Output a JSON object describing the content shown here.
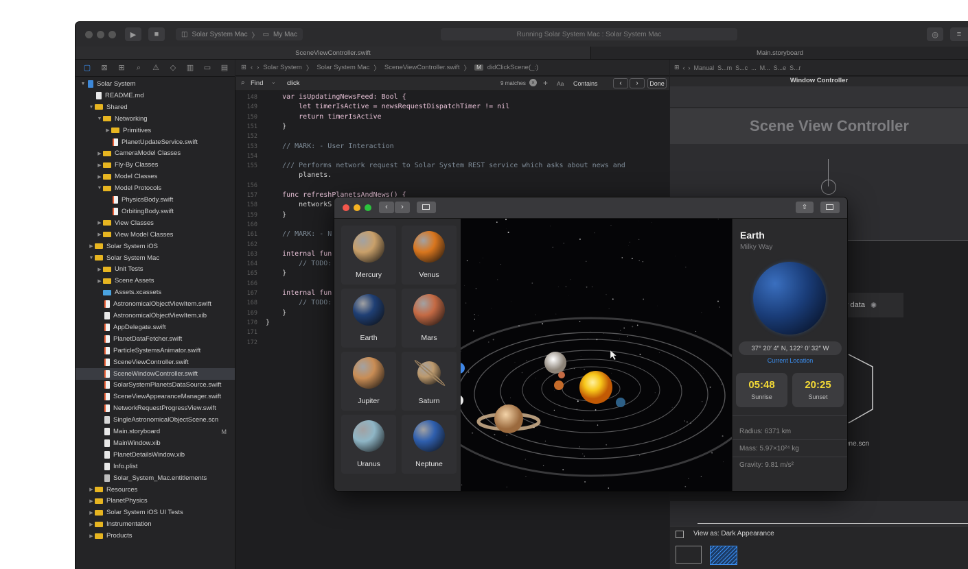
{
  "titlebar": {
    "scheme_target": "Solar System Mac",
    "scheme_destination": "My Mac",
    "activity": "Running Solar System Mac : Solar System Mac"
  },
  "tabs": [
    {
      "label": "SceneViewController.swift"
    },
    {
      "label": "Main.storyboard"
    }
  ],
  "navigator": {
    "items": [
      {
        "label": "Solar System",
        "kind": "proj",
        "depth": 0,
        "disc": "open"
      },
      {
        "label": "README.md",
        "kind": "file",
        "depth": 1,
        "disc": ""
      },
      {
        "label": "Shared",
        "kind": "folder",
        "depth": 1,
        "disc": "open"
      },
      {
        "label": "Networking",
        "kind": "folder",
        "depth": 2,
        "disc": "open"
      },
      {
        "label": "Primitives",
        "kind": "folder",
        "depth": 3,
        "disc": "closed"
      },
      {
        "label": "PlanetUpdateService.swift",
        "kind": "swift",
        "depth": 3,
        "disc": ""
      },
      {
        "label": "CameraModel Classes",
        "kind": "folder",
        "depth": 2,
        "disc": "closed"
      },
      {
        "label": "Fly-By Classes",
        "kind": "folder",
        "depth": 2,
        "disc": "closed"
      },
      {
        "label": "Model Classes",
        "kind": "folder",
        "depth": 2,
        "disc": "closed"
      },
      {
        "label": "Model Protocols",
        "kind": "folder",
        "depth": 2,
        "disc": "open"
      },
      {
        "label": "PhysicsBody.swift",
        "kind": "swift",
        "depth": 3,
        "disc": ""
      },
      {
        "label": "OrbitingBody.swift",
        "kind": "swift",
        "depth": 3,
        "disc": ""
      },
      {
        "label": "View Classes",
        "kind": "folder",
        "depth": 2,
        "disc": "closed"
      },
      {
        "label": "View Model Classes",
        "kind": "folder",
        "depth": 2,
        "disc": "closed"
      },
      {
        "label": "Solar System iOS",
        "kind": "folder",
        "depth": 1,
        "disc": "closed"
      },
      {
        "label": "Solar System Mac",
        "kind": "folder",
        "depth": 1,
        "disc": "open"
      },
      {
        "label": "Unit Tests",
        "kind": "folder",
        "depth": 2,
        "disc": "closed"
      },
      {
        "label": "Scene Assets",
        "kind": "folder",
        "depth": 2,
        "disc": "closed"
      },
      {
        "label": "Assets.xcassets",
        "kind": "bluefolder",
        "depth": 2,
        "disc": ""
      },
      {
        "label": "AstronomicalObjectViewItem.swift",
        "kind": "swift",
        "depth": 2,
        "disc": ""
      },
      {
        "label": "AstronomicalObjectViewItem.xib",
        "kind": "file",
        "depth": 2,
        "disc": ""
      },
      {
        "label": "AppDelegate.swift",
        "kind": "swift",
        "depth": 2,
        "disc": ""
      },
      {
        "label": "PlanetDataFetcher.swift",
        "kind": "swift",
        "depth": 2,
        "disc": ""
      },
      {
        "label": "ParticleSystemsAnimator.swift",
        "kind": "swift",
        "depth": 2,
        "disc": ""
      },
      {
        "label": "SceneViewController.swift",
        "kind": "swift",
        "depth": 2,
        "disc": ""
      },
      {
        "label": "SceneWindowController.swift",
        "kind": "swift",
        "depth": 2,
        "disc": "",
        "selected": true
      },
      {
        "label": "SolarSystemPlanetsDataSource.swift",
        "kind": "swift",
        "depth": 2,
        "disc": ""
      },
      {
        "label": "SceneViewAppearanceManager.swift",
        "kind": "swift",
        "depth": 2,
        "disc": ""
      },
      {
        "label": "NetworkRequestProgressView.swift",
        "kind": "swift",
        "depth": 2,
        "disc": ""
      },
      {
        "label": "SingleAstronomicalObjectScene.scn",
        "kind": "scn",
        "depth": 2,
        "disc": ""
      },
      {
        "label": "Main.storyboard",
        "kind": "file",
        "depth": 2,
        "disc": "",
        "badge": "M"
      },
      {
        "label": "MainWindow.xib",
        "kind": "file",
        "depth": 2,
        "disc": ""
      },
      {
        "label": "PlanetDetailsWindow.xib",
        "kind": "file",
        "depth": 2,
        "disc": ""
      },
      {
        "label": "Info.plist",
        "kind": "file",
        "depth": 2,
        "disc": ""
      },
      {
        "label": "Solar_System_Mac.entitlements",
        "kind": "ent",
        "depth": 2,
        "disc": ""
      },
      {
        "label": "Resources",
        "kind": "folder",
        "depth": 1,
        "disc": "closed"
      },
      {
        "label": "PlanetPhysics",
        "kind": "folder",
        "depth": 1,
        "disc": "closed"
      },
      {
        "label": "Solar System iOS UI Tests",
        "kind": "folder",
        "depth": 1,
        "disc": "closed"
      },
      {
        "label": "Instrumentation",
        "kind": "folder",
        "depth": 1,
        "disc": "closed"
      },
      {
        "label": "Products",
        "kind": "folder",
        "depth": 1,
        "disc": "closed"
      }
    ]
  },
  "jumpbar": {
    "crumbs": [
      "Solar System",
      "Solar System Mac",
      "SceneViewController.swift",
      "didClickScene(_:)"
    ],
    "method_badge": "M"
  },
  "find": {
    "mode": "Find",
    "query": "click",
    "matches": "9 matches",
    "case": "Aa",
    "option": "Contains",
    "done": "Done"
  },
  "code": {
    "lines": [
      {
        "n": "148",
        "t": "    var isUpdatingNewsFeed: Bool {"
      },
      {
        "n": "149",
        "t": "        let timerIsActive = newsRequestDispatchTimer != nil"
      },
      {
        "n": "150",
        "t": "        return timerIsActive"
      },
      {
        "n": "151",
        "t": "    }"
      },
      {
        "n": "152",
        "t": ""
      },
      {
        "n": "153",
        "t": "    // MARK: - User Interaction"
      },
      {
        "n": "154",
        "t": ""
      },
      {
        "n": "155",
        "t": "    /// Performs network request to Solar System REST service which asks about news and"
      },
      {
        "n": "",
        "t": "        planets."
      },
      {
        "n": "156",
        "t": ""
      },
      {
        "n": "157",
        "t": "    func refreshPlanetsAndNews() {"
      },
      {
        "n": "158",
        "t": "        networkS"
      },
      {
        "n": "159",
        "t": "    }"
      },
      {
        "n": "160",
        "t": ""
      },
      {
        "n": "161",
        "t": "    // MARK: - N"
      },
      {
        "n": "162",
        "t": ""
      },
      {
        "n": "163",
        "t": "    internal fun"
      },
      {
        "n": "164",
        "t": "        // TODO:"
      },
      {
        "n": "165",
        "t": "    }"
      },
      {
        "n": "166",
        "t": ""
      },
      {
        "n": "167",
        "t": "    internal fun"
      },
      {
        "n": "168",
        "t": "        // TODO:"
      },
      {
        "n": "169",
        "t": "    }"
      },
      {
        "n": "170",
        "t": "}"
      },
      {
        "n": "171",
        "t": ""
      },
      {
        "n": "172",
        "t": ""
      }
    ]
  },
  "ib": {
    "crumbs": [
      "Manual",
      "S...m",
      "S...c",
      "...",
      "M...",
      "S...e",
      "S...r"
    ],
    "window_controller": "Window Controller",
    "scene_title": "Scene View Controller",
    "fragment_data": "y data",
    "fragment_scn": "ene.scn",
    "view_as": "View as: Dark Appearance"
  },
  "app": {
    "planets": [
      {
        "name": "Mercury",
        "color": "#c9a06a"
      },
      {
        "name": "Venus",
        "color": "#d9761e"
      },
      {
        "name": "Earth",
        "color": "#1f3f74"
      },
      {
        "name": "Mars",
        "color": "#c46a44"
      },
      {
        "name": "Jupiter",
        "color": "#c98d55"
      },
      {
        "name": "Saturn",
        "color": "#bd9a6e"
      },
      {
        "name": "Uranus",
        "color": "#8fb6c6"
      },
      {
        "name": "Neptune",
        "color": "#2f5fae"
      }
    ],
    "detail": {
      "name": "Earth",
      "galaxy": "Milky Way",
      "coords": "37° 20′ 4″ N, 122° 0′ 32″ W",
      "location_link": "Current Location",
      "sunrise_time": "05:48",
      "sunrise_label": "Sunrise",
      "sunset_time": "20:25",
      "sunset_label": "Sunset",
      "radius": "Radius: 6371 km",
      "mass": "Mass: 5.97×10²⁴ kg",
      "gravity": "Gravity: 9.81 m/s²"
    }
  },
  "colors": {
    "accent": "#3b8ef0",
    "time_yellow": "#f3d936",
    "folder": "#e7b521"
  }
}
